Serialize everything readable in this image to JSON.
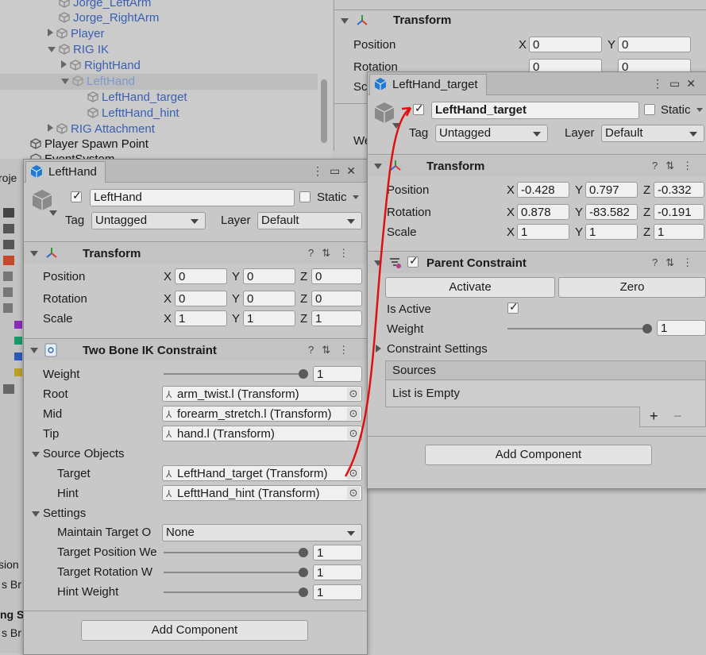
{
  "hierarchy": {
    "items": [
      {
        "label": "Jorge_LeftArm"
      },
      {
        "label": "Jorge_RightArm"
      },
      {
        "label": "Player"
      },
      {
        "label": "RIG IK"
      },
      {
        "label": "RightHand"
      },
      {
        "label": "LeftHand"
      },
      {
        "label": "LeftHand_target"
      },
      {
        "label": "LefttHand_hint"
      },
      {
        "label": "RIG Attachment"
      },
      {
        "label": "Player Spawn Point"
      },
      {
        "label": "EventSystem"
      }
    ],
    "sidebar_fragments": [
      "roje",
      "sion",
      "s Br",
      "ng S",
      "s Br"
    ]
  },
  "bg_inspector": {
    "transform": "Transform",
    "position": "Position",
    "rotation": "Rotation",
    "scale_short": "Sc",
    "we": "We",
    "x": "X",
    "y": "Y",
    "pos_x": "0",
    "pos_y": "0",
    "rot_x": "0",
    "rot_y": "0"
  },
  "left_window": {
    "tab": "LeftHand",
    "name": "LeftHand",
    "static": "Static",
    "tag_label": "Tag",
    "tag_value": "Untagged",
    "layer_label": "Layer",
    "layer_value": "Default",
    "transform": {
      "title": "Transform",
      "position": "Position",
      "rotation": "Rotation",
      "scale": "Scale",
      "x": "X",
      "y": "Y",
      "z": "Z",
      "pos": [
        "0",
        "0",
        "0"
      ],
      "rot": [
        "0",
        "0",
        "0"
      ],
      "scl": [
        "1",
        "1",
        "1"
      ]
    },
    "ik": {
      "title": "Two Bone IK Constraint",
      "weight_label": "Weight",
      "weight": "1",
      "weight_frac": 1.0,
      "root_label": "Root",
      "root": "arm_twist.l (Transform)",
      "mid_label": "Mid",
      "mid": "forearm_stretch.l (Transform)",
      "tip_label": "Tip",
      "tip": "hand.l (Transform)",
      "source_objects": "Source Objects",
      "target_label": "Target",
      "target": "LeftHand_target (Transform)",
      "hint_label": "Hint",
      "hint": "LefttHand_hint (Transform)",
      "settings": "Settings",
      "maintain_label": "Maintain Target O",
      "maintain_value": "None",
      "tpw_label": "Target Position We",
      "tpw": "1",
      "trw_label": "Target Rotation W",
      "trw": "1",
      "hw_label": "Hint Weight",
      "hw": "1"
    },
    "add_component": "Add Component"
  },
  "right_window": {
    "tab": "LeftHand_target",
    "name": "LeftHand_target",
    "static": "Static",
    "tag_label": "Tag",
    "tag_value": "Untagged",
    "layer_label": "Layer",
    "layer_value": "Default",
    "transform": {
      "title": "Transform",
      "position": "Position",
      "rotation": "Rotation",
      "scale": "Scale",
      "x": "X",
      "y": "Y",
      "z": "Z",
      "pos": [
        "-0.428",
        "0.797",
        "-0.332"
      ],
      "rot": [
        "0.878",
        "-83.582",
        "-0.191"
      ],
      "scl": [
        "1",
        "1",
        "1"
      ]
    },
    "parent": {
      "title": "Parent Constraint",
      "activate": "Activate",
      "zero": "Zero",
      "is_active": "Is Active",
      "weight_label": "Weight",
      "weight": "1",
      "weight_frac": 1.0,
      "settings": "Constraint Settings",
      "sources": "Sources",
      "empty": "List is Empty",
      "plus": "+",
      "minus": "−"
    },
    "add_component": "Add Component"
  },
  "colors": {
    "link_blue": "#3a5fb0",
    "arrow": "#e01010",
    "unity_blue": "#1f7ad6"
  }
}
